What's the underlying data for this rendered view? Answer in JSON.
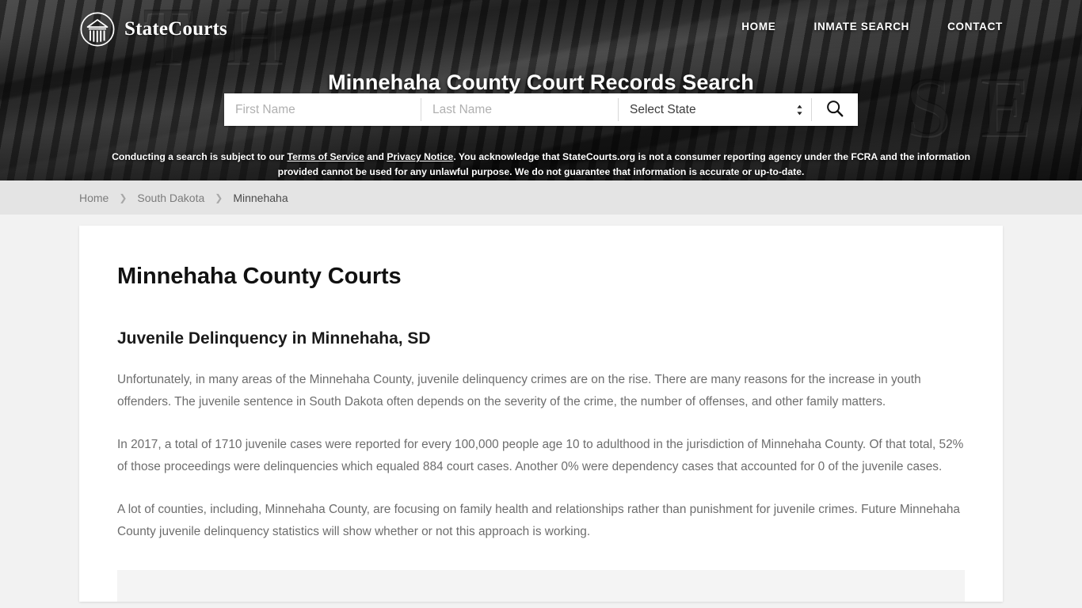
{
  "header": {
    "brand_name": "StateCourts",
    "brand_icon": "courthouse-circle-logo",
    "carving_right": "SE",
    "carving_left": "TH",
    "nav": [
      {
        "label": "HOME"
      },
      {
        "label": "INMATE SEARCH"
      },
      {
        "label": "CONTACT"
      }
    ],
    "title": "Minnehaha County Court Records Search"
  },
  "search": {
    "first_name_value": "",
    "first_name_placeholder": "First Name",
    "last_name_value": "",
    "last_name_placeholder": "Last Name",
    "state_selected": "Select State",
    "state_options": [
      "Select State"
    ],
    "search_icon": "magnifier-icon",
    "spinner_icon": "select-updown-chevron-icon"
  },
  "disclaimer": {
    "part1": "Conducting a search is subject to our ",
    "link1": "Terms of Service",
    "part2": " and ",
    "link2": "Privacy Notice",
    "part3": ". You acknowledge that StateCourts.org is not a consumer reporting agency under the FCRA and the information provided cannot be used for any unlawful purpose. We do not guarantee that information is accurate or up-to-date."
  },
  "breadcrumb": {
    "items": [
      {
        "label": "Home",
        "current": false
      },
      {
        "label": "South Dakota",
        "current": false
      },
      {
        "label": "Minnehaha",
        "current": true
      }
    ],
    "separator": "❯"
  },
  "main": {
    "page_title": "Minnehaha County Courts",
    "section_heading": "Juvenile Delinquency in Minnehaha, SD",
    "paragraph_1": "Unfortunately, in many areas of the Minnehaha County, juvenile delinquency crimes are on the rise. There are many reasons for the increase in youth offenders. The juvenile sentence in South Dakota often depends on the severity of the crime, the number of offenses, and other family matters.",
    "paragraph_2": "In 2017, a total of 1710 juvenile cases were reported for every 100,000 people age 10 to adulthood in the jurisdiction of Minnehaha County. Of that total, 52% of those proceedings were delinquencies which equaled 884 court cases. Another 0% were dependency cases that accounted for 0 of the juvenile cases.",
    "paragraph_3": "A lot of counties, including, Minnehaha County, are focusing on family health and relationships rather than punishment for juvenile crimes. Future Minnehaha County juvenile delinquency statistics will show whether or not this approach is working."
  },
  "colors": {
    "page_background": "#f2f2f2",
    "breadcrumb_background": "#e4e4e4",
    "card_background": "#ffffff",
    "hero_background": "#3a3a3a",
    "body_text": "#6d6d6d",
    "heading_text": "#111111"
  }
}
